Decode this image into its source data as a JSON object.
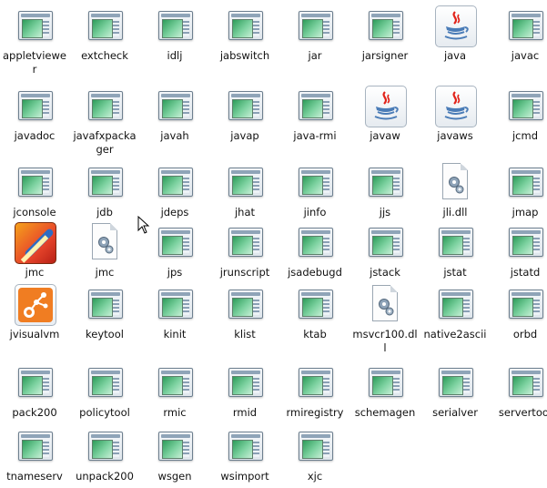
{
  "files": [
    {
      "name": "appletviewer",
      "icon": "exe-window-icon"
    },
    {
      "name": "extcheck",
      "icon": "exe-window-icon"
    },
    {
      "name": "idlj",
      "icon": "exe-window-icon"
    },
    {
      "name": "jabswitch",
      "icon": "exe-window-icon"
    },
    {
      "name": "jar",
      "icon": "exe-window-icon"
    },
    {
      "name": "jarsigner",
      "icon": "exe-window-icon"
    },
    {
      "name": "java",
      "icon": "java-cup-icon"
    },
    {
      "name": "javac",
      "icon": "exe-window-icon"
    },
    {
      "name": "javadoc",
      "icon": "exe-window-icon"
    },
    {
      "name": "javafxpackager",
      "icon": "exe-window-icon"
    },
    {
      "name": "javah",
      "icon": "exe-window-icon"
    },
    {
      "name": "javap",
      "icon": "exe-window-icon"
    },
    {
      "name": "java-rmi",
      "icon": "exe-window-icon"
    },
    {
      "name": "javaw",
      "icon": "java-cup-icon"
    },
    {
      "name": "javaws",
      "icon": "java-cup-icon"
    },
    {
      "name": "jcmd",
      "icon": "exe-window-icon"
    },
    {
      "name": "jconsole",
      "icon": "exe-window-icon"
    },
    {
      "name": "jdb",
      "icon": "exe-window-icon"
    },
    {
      "name": "jdeps",
      "icon": "exe-window-icon"
    },
    {
      "name": "jhat",
      "icon": "exe-window-icon"
    },
    {
      "name": "jinfo",
      "icon": "exe-window-icon"
    },
    {
      "name": "jjs",
      "icon": "exe-window-icon"
    },
    {
      "name": "jli.dll",
      "icon": "dll-gear-icon"
    },
    {
      "name": "jmap",
      "icon": "exe-window-icon"
    },
    {
      "name": "jmc",
      "icon": "jmc-app-icon"
    },
    {
      "name": "jmc",
      "icon": "gear-doc-icon"
    },
    {
      "name": "jps",
      "icon": "exe-window-icon"
    },
    {
      "name": "jrunscript",
      "icon": "exe-window-icon"
    },
    {
      "name": "jsadebugd",
      "icon": "exe-window-icon"
    },
    {
      "name": "jstack",
      "icon": "exe-window-icon"
    },
    {
      "name": "jstat",
      "icon": "exe-window-icon"
    },
    {
      "name": "jstatd",
      "icon": "exe-window-icon"
    },
    {
      "name": "jvisualvm",
      "icon": "visualvm-icon"
    },
    {
      "name": "keytool",
      "icon": "exe-window-icon"
    },
    {
      "name": "kinit",
      "icon": "exe-window-icon"
    },
    {
      "name": "klist",
      "icon": "exe-window-icon"
    },
    {
      "name": "ktab",
      "icon": "exe-window-icon"
    },
    {
      "name": "msvcr100.dll",
      "icon": "dll-gear-icon"
    },
    {
      "name": "native2ascii",
      "icon": "exe-window-icon"
    },
    {
      "name": "orbd",
      "icon": "exe-window-icon"
    },
    {
      "name": "pack200",
      "icon": "exe-window-icon"
    },
    {
      "name": "policytool",
      "icon": "exe-window-icon"
    },
    {
      "name": "rmic",
      "icon": "exe-window-icon"
    },
    {
      "name": "rmid",
      "icon": "exe-window-icon"
    },
    {
      "name": "rmiregistry",
      "icon": "exe-window-icon"
    },
    {
      "name": "schemagen",
      "icon": "exe-window-icon"
    },
    {
      "name": "serialver",
      "icon": "exe-window-icon"
    },
    {
      "name": "servertool",
      "icon": "exe-window-icon"
    },
    {
      "name": "tnameserv",
      "icon": "exe-window-icon"
    },
    {
      "name": "unpack200",
      "icon": "exe-window-icon"
    },
    {
      "name": "wsgen",
      "icon": "exe-window-icon"
    },
    {
      "name": "wsimport",
      "icon": "exe-window-icon"
    },
    {
      "name": "xjc",
      "icon": "exe-window-icon"
    }
  ]
}
